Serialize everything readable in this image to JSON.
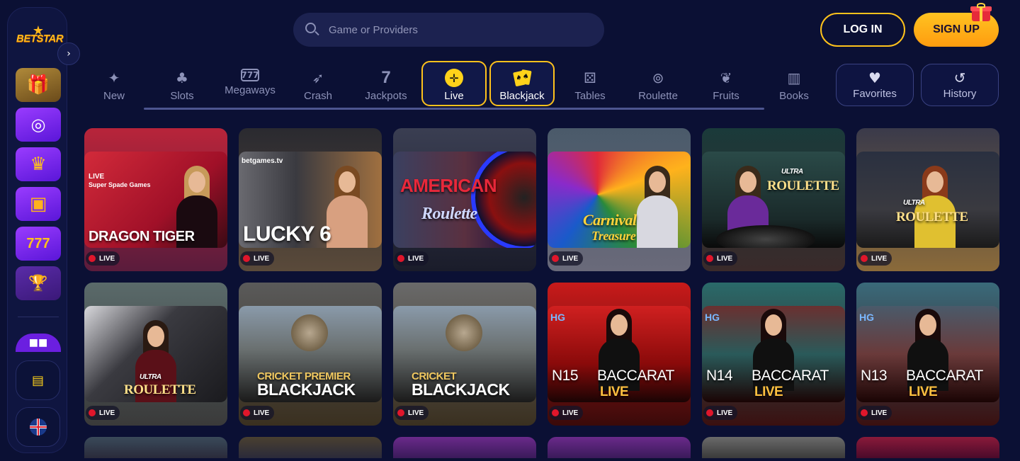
{
  "brand": {
    "name": "BETSTAR"
  },
  "header": {
    "search_placeholder": "Game or Providers",
    "login_label": "LOG IN",
    "signup_label": "SIGN UP"
  },
  "sidebar": {
    "tiles": [
      {
        "name": "gift-promo-icon"
      },
      {
        "name": "target-icon"
      },
      {
        "name": "crown-icon"
      },
      {
        "name": "gift-box-icon"
      },
      {
        "name": "slot-777-icon"
      },
      {
        "name": "trophy-icon"
      }
    ],
    "bottom": [
      {
        "name": "chat-icon"
      },
      {
        "name": "language-flag-icon"
      }
    ]
  },
  "categories": [
    {
      "label": "New",
      "icon": "rocket-icon",
      "active": false
    },
    {
      "label": "Slots",
      "icon": "cherries-icon",
      "active": false
    },
    {
      "label": "Megaways",
      "icon": "777-icon",
      "active": false
    },
    {
      "label": "Crash",
      "icon": "rocket-icon",
      "active": false
    },
    {
      "label": "Jackpots",
      "icon": "seven-icon",
      "active": false
    },
    {
      "label": "Live",
      "icon": "live-icon",
      "active": true
    },
    {
      "label": "Blackjack",
      "icon": "cards-icon",
      "active": true
    },
    {
      "label": "Tables",
      "icon": "dice-icon",
      "active": false
    },
    {
      "label": "Roulette",
      "icon": "roulette-icon",
      "active": false
    },
    {
      "label": "Fruits",
      "icon": "fruit-icon",
      "active": false
    },
    {
      "label": "Books",
      "icon": "book-icon",
      "active": false
    }
  ],
  "quick": {
    "favorites_label": "Favorites",
    "history_label": "History"
  },
  "live_badge": "LIVE",
  "games": [
    {
      "title": "DRAGON TIGER",
      "provider": "Super Spade Games",
      "provider_tag": "LIVE"
    },
    {
      "title": "LUCKY 6",
      "provider": "betgames.tv"
    },
    {
      "title_top": "AMERICAN",
      "title_bottom": "Roulette"
    },
    {
      "title_top": "Carnival",
      "title_bottom": "Treasure"
    },
    {
      "title_top": "ULTRA",
      "title_bottom": "ROULETTE"
    },
    {
      "title_top": "ULTRA",
      "title_bottom": "ROULETTE"
    },
    {
      "title_top": "ULTRA",
      "title_bottom": "ROULETTE"
    },
    {
      "title_top": "CRICKET PREMIER",
      "title_bottom": "BLACKJACK"
    },
    {
      "title_top": "CRICKET",
      "title_bottom": "BLACKJACK"
    },
    {
      "table": "N15",
      "title_top": "BACCARAT",
      "title_bottom": "LIVE",
      "provider": "HG"
    },
    {
      "table": "N14",
      "title_top": "BACCARAT",
      "title_bottom": "LIVE",
      "provider": "HG"
    },
    {
      "table": "N13",
      "title_top": "BACCARAT",
      "title_bottom": "LIVE",
      "provider": "HG"
    }
  ]
}
